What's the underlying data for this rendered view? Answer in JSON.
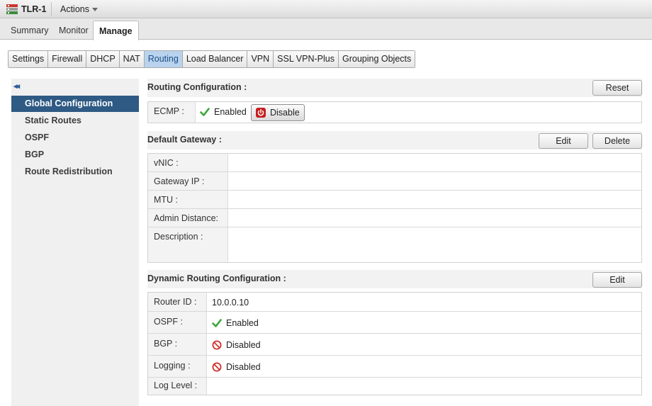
{
  "window": {
    "title": "TLR-1",
    "actions_label": "Actions"
  },
  "top_tabs": [
    {
      "label": "Summary"
    },
    {
      "label": "Monitor"
    },
    {
      "label": "Manage",
      "active": true
    }
  ],
  "sub_tabs": [
    {
      "label": "Settings"
    },
    {
      "label": "Firewall"
    },
    {
      "label": "DHCP"
    },
    {
      "label": "NAT"
    },
    {
      "label": "Routing",
      "active": true
    },
    {
      "label": "Load Balancer"
    },
    {
      "label": "VPN"
    },
    {
      "label": "SSL VPN-Plus"
    },
    {
      "label": "Grouping Objects"
    }
  ],
  "sidebar": {
    "collapse_glyph": "◂◂",
    "items": [
      {
        "label": "Global Configuration",
        "active": true
      },
      {
        "label": "Static Routes"
      },
      {
        "label": "OSPF"
      },
      {
        "label": "BGP"
      },
      {
        "label": "Route Redistribution"
      }
    ]
  },
  "routing_config": {
    "title": "Routing Configuration :",
    "reset_label": "Reset",
    "ecmp_label": "ECMP :",
    "ecmp_status": "Enabled",
    "disable_label": "Disable"
  },
  "default_gateway": {
    "title": "Default Gateway :",
    "edit_label": "Edit",
    "delete_label": "Delete",
    "fields": [
      {
        "label": "vNIC :",
        "value": ""
      },
      {
        "label": "Gateway IP :",
        "value": ""
      },
      {
        "label": "MTU :",
        "value": ""
      },
      {
        "label": "Admin Distance:",
        "value": ""
      },
      {
        "label": "Description :",
        "value": ""
      }
    ]
  },
  "dynamic_routing": {
    "title": "Dynamic Routing Configuration :",
    "edit_label": "Edit",
    "fields": [
      {
        "label": "Router ID :",
        "value": "10.0.0.10",
        "icon": ""
      },
      {
        "label": "OSPF :",
        "value": "Enabled",
        "icon": "check-icon"
      },
      {
        "label": "BGP :",
        "value": "Disabled",
        "icon": "disabled-icon"
      },
      {
        "label": "Logging :",
        "value": "Disabled",
        "icon": "disabled-icon"
      },
      {
        "label": "Log Level :",
        "value": "",
        "icon": ""
      }
    ]
  },
  "colors": {
    "nav_active": "#2e5a84",
    "tab_active": "#b9d3ee",
    "enabled_green": "#3aa63a",
    "disabled_red": "#d0312d",
    "power_red": "#c51c1c"
  }
}
